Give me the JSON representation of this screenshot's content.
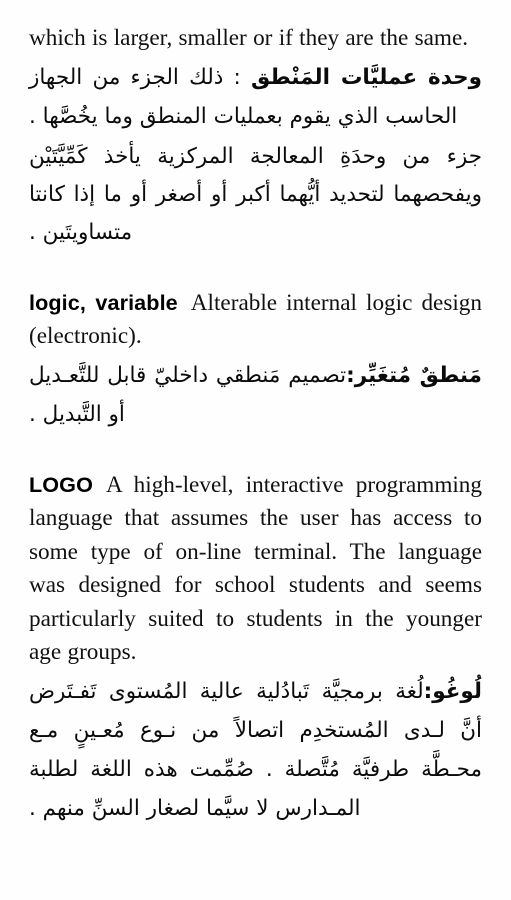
{
  "page": {
    "language_primary": "English",
    "language_secondary": "Arabic",
    "background_color": "#fefefe",
    "text_color": "#0a0a0a"
  },
  "entries": [
    {
      "id": "arithmetic-logic-unit-continuation",
      "headword": "",
      "english_definition": "which is larger, smaller or if they are the same.",
      "arabic_headword": "وحدة عمليَّات المَنْطق",
      "arabic_separator": " : ",
      "arabic_definition": "ذلك الجزء من الجهاز الحاسب الذي يقوم بعمليات المنطق وما يخُصَّها .",
      "arabic_extra": "جزء من وحدَةِ المعالجة المركزية يأخذ كَمِّيَّتَيْن ويفحصهما لتحديد أيُّهما أكبر أو أصغر أو ما إذا كانتا متساويتَين ."
    },
    {
      "id": "logic-variable",
      "headword": "logic, variable",
      "english_definition": "Alterable internal logic design (electronic).",
      "arabic_headword": "مَنطقٌ مُتغَيِّر:",
      "arabic_definition": "تصميم مَنطقي داخليّ قابل للتَّعـديل أو التَّبديل ."
    },
    {
      "id": "logo",
      "headword": "LOGO",
      "english_definition": "A high-level, interactive programming language that assumes the user has access to some type of on-line terminal. The language was designed for school students and seems particularly suited to students in the younger age groups.",
      "arabic_headword": "لُوغُو:",
      "arabic_definition": "لُغة برمجيَّة تَبادُلية عالية المُستوى تَفـتَرض أنَّ لـدى المُستخدِم اتصالاً من نـوع مُعـينٍ مـع محـطَّة طرفيَّة مُتَّصلة . صُمِّمت هذه اللغة لطلبة المـدارس لا سيَّما لصغار السنِّ منهم ."
    }
  ]
}
